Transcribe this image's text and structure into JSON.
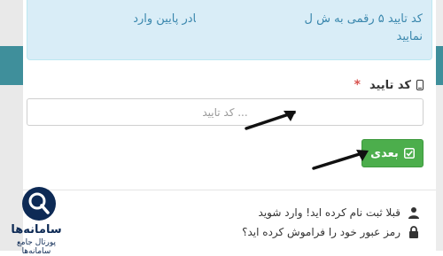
{
  "alert": {
    "line1": "کد تایید ۵ رقمی به ش                    ل شده است. آن را در کادر پایین وارد",
    "line2": "نمایید"
  },
  "code_field": {
    "label": "کد تایید",
    "required_mark": "*",
    "placeholder": "... کد تایید",
    "value": ""
  },
  "next_button": {
    "label": "بعدی"
  },
  "links": {
    "login_text": "قبلا ثبت نام کرده اید! وارد شوید",
    "forgot_text": "رمز عبور خود را فراموش کرده اید؟"
  },
  "watermark": {
    "brand": "سامانه‌ها",
    "tagline": "پورتال جامع سامانه‌ها"
  },
  "colors": {
    "alert_bg": "#d9edf7",
    "alert_text": "#3a87ad",
    "button_green": "#4cae4c",
    "required_red": "#d9534f"
  },
  "icons": [
    "mobile-phone-icon",
    "check-square-icon",
    "user-icon",
    "lock-icon"
  ]
}
